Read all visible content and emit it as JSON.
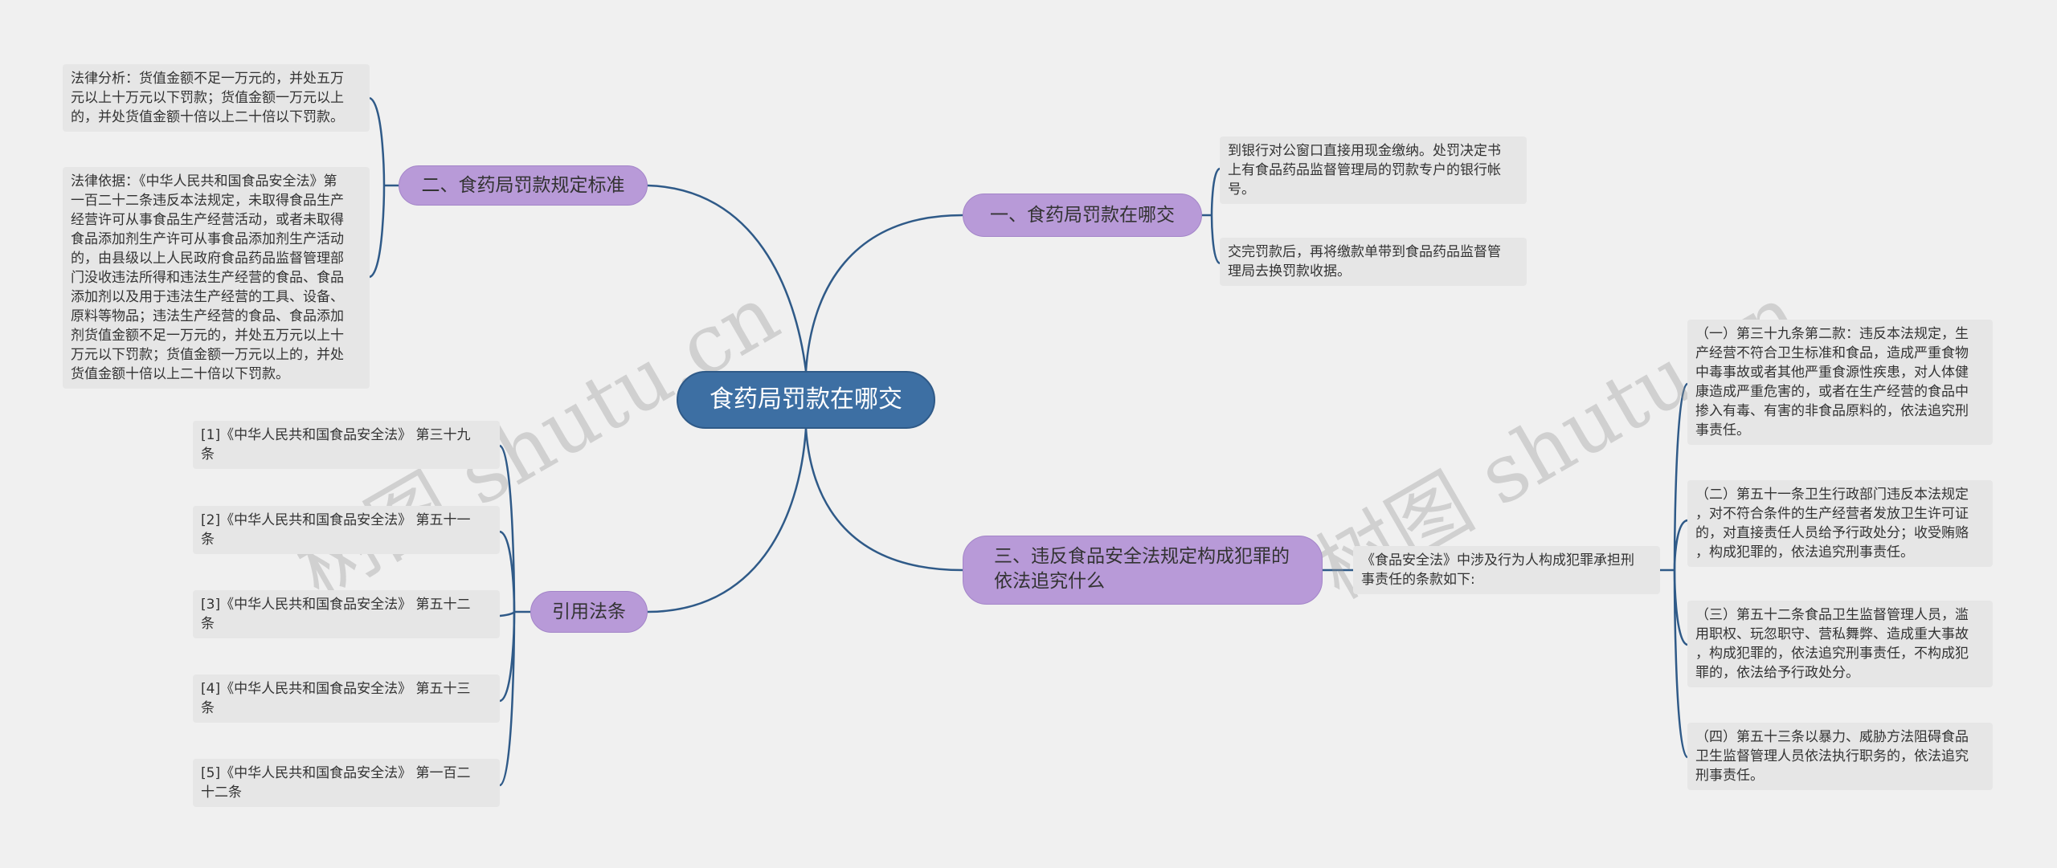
{
  "root": {
    "label": "食药局罚款在哪交"
  },
  "branches": {
    "standard": {
      "label": "二、食药局罚款规定标准",
      "leaves": [
        "法律分析：货值金额不足一万元的，并处五万\n元以上十万元以下罚款；货值金额一万元以上\n的，并处货值金额十倍以上二十倍以下罚款。",
        "法律依据：《中华人民共和国食品安全法》第\n一百二十二条违反本法规定，未取得食品生产\n经营许可从事食品生产经营活动，或者未取得\n食品添加剂生产许可从事食品添加剂生产活动\n的，由县级以上人民政府食品药品监督管理部\n门没收违法所得和违法生产经营的食品、食品\n添加剂以及用于违法生产经营的工具、设备、\n原料等物品；违法生产经营的食品、食品添加\n剂货值金额不足一万元的，并处五万元以上十\n万元以下罚款；货值金额一万元以上的，并处\n货值金额十倍以上二十倍以下罚款。"
      ]
    },
    "where": {
      "label": "一、食药局罚款在哪交",
      "leaves": [
        "到银行对公窗口直接用现金缴纳。处罚决定书\n上有食品药品监督管理局的罚款专户的银行帐\n号。",
        "交完罚款后，再将缴款单带到食品药品监督管\n理局去换罚款收据。"
      ]
    },
    "crime": {
      "label": "三、违反食品安全法规定构成犯罪的依法追究什么",
      "middle": "《食品安全法》中涉及行为人构成犯罪承担刑\n事责任的条款如下:",
      "leaves": [
        "（一）第三十九条第二款：违反本法规定，生\n产经营不符合卫生标准和食品，造成严重食物\n中毒事故或者其他严重食源性疾患，对人体健\n康造成严重危害的，或者在生产经营的食品中\n掺入有毒、有害的非食品原料的，依法追究刑\n事责任。",
        "（二）第五十一条卫生行政部门违反本法规定\n，对不符合条件的生产经营者发放卫生许可证\n的，对直接责任人员给予行政处分；收受贿赂\n，构成犯罪的，依法追究刑事责任。",
        "（三）第五十二条食品卫生监督管理人员，滥\n用职权、玩忽职守、营私舞弊、造成重大事故\n，构成犯罪的，依法追究刑事责任，不构成犯\n罪的，依法给予行政处分。",
        "（四）第五十三条以暴力、威胁方法阻碍食品\n卫生监督管理人员依法执行职务的，依法追究\n刑事责任。"
      ]
    },
    "refs": {
      "label": "引用法条",
      "leaves": [
        "[1]《中华人民共和国食品安全法》 第三十九\n条",
        "[2]《中华人民共和国食品安全法》 第五十一\n条",
        "[3]《中华人民共和国食品安全法》 第五十二\n条",
        "[4]《中华人民共和国食品安全法》 第五十三\n条",
        "[5]《中华人民共和国食品安全法》 第一百二\n十二条"
      ]
    }
  },
  "watermarks": [
    "树图 shutu.cn",
    "树图 shutu.cn"
  ],
  "colors": {
    "background": "#f0f0f0",
    "root": "#3d6fa3",
    "branch": "#b89ad8",
    "leaf": "#e6e6e6",
    "link": "#2f5a88"
  }
}
